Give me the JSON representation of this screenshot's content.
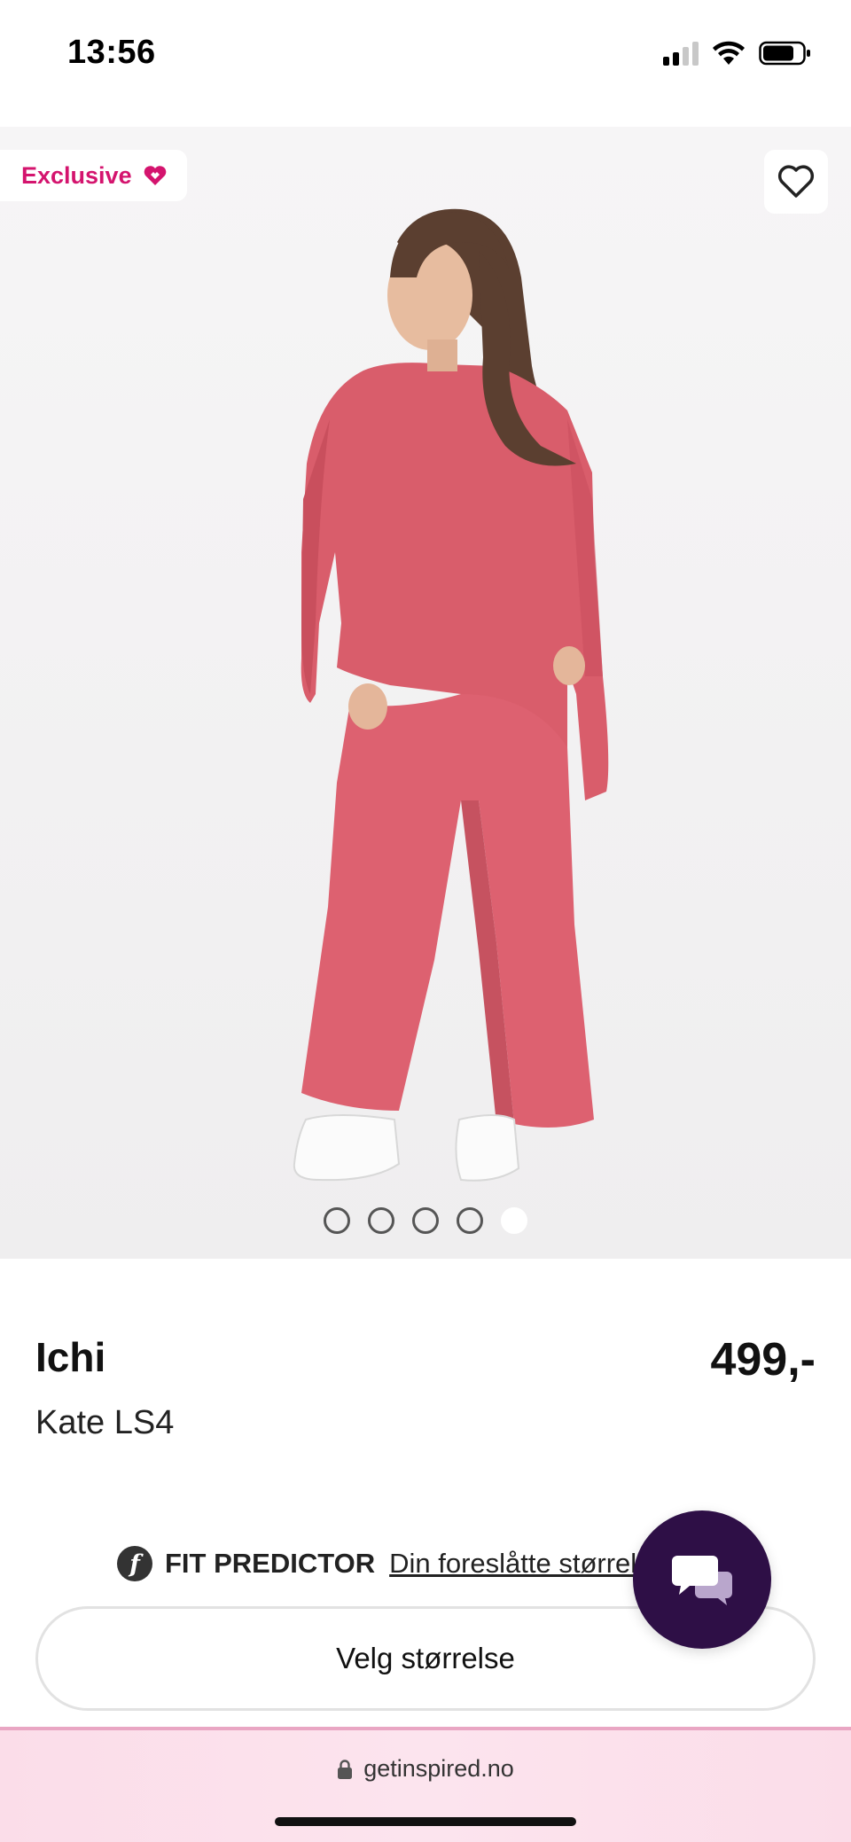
{
  "status_bar": {
    "time": "13:56"
  },
  "product": {
    "badge": "Exclusive",
    "brand": "Ichi",
    "name": "Kate LS4",
    "price": "499,-",
    "image_count": 5,
    "active_image_index": 5
  },
  "fit_predictor": {
    "logo_letter": "f",
    "title": "FIT PREDICTOR",
    "link": "Din foreslåtte størrelse"
  },
  "size_button": {
    "label": "Velg størrelse"
  },
  "browser": {
    "url": "getinspired.no"
  },
  "colors": {
    "accent": "#d4146e",
    "chat_bg": "#2e0f46",
    "garment": "#db5f6c",
    "url_bar_bg": "#fce4ee"
  },
  "icons": {
    "badge": "heart-icon",
    "wishlist": "heart-outline-icon",
    "chat": "chat-bubbles-icon",
    "url": "lock-icon"
  }
}
